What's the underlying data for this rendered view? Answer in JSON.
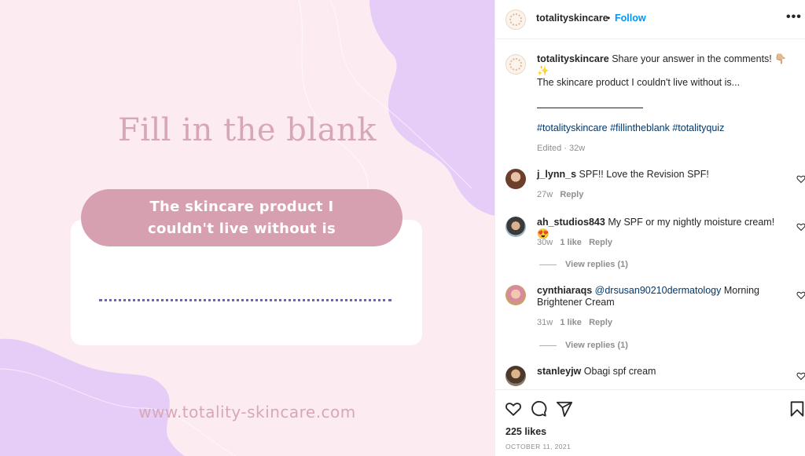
{
  "post_image": {
    "title": "Fill in the blank",
    "pill_text": "The skincare product I couldn't live without is",
    "website": "www.totality-skincare.com",
    "colors": {
      "background": "#fcecf2",
      "blob": "#e6cdf7",
      "pill": "#d7a0b0",
      "title": "#d7a7b5",
      "dotted_line": "#7b56d8"
    }
  },
  "header": {
    "username": "totalityskincare",
    "separator": "•",
    "follow_label": "Follow",
    "more_icon": "more-options-icon",
    "more_glyph": "•••"
  },
  "caption": {
    "username": "totalityskincare",
    "text": "Share your answer in the comments! 👇🏼✨",
    "line2": "The skincare product I couldn't live without is...",
    "hashtags": "#totalityskincare #fillintheblank #totalityquiz",
    "meta": "Edited · 32w"
  },
  "comments": [
    {
      "username": "j_lynn_s",
      "text": "SPF!! Love the Revision SPF!",
      "time": "27w",
      "likes": "",
      "reply": "Reply",
      "view_replies": ""
    },
    {
      "username": "ah_studios843",
      "text": "My SPF or my nightly moisture cream! 😍",
      "time": "30w",
      "likes": "1 like",
      "reply": "Reply",
      "view_replies": "View replies (1)"
    },
    {
      "username": "cynthiaraqs",
      "mention": "@drsusan90210dermatology",
      "text_line1_rest": " Morning",
      "text_line2": "Brightener Cream",
      "time": "31w",
      "likes": "1 like",
      "reply": "Reply",
      "view_replies": "View replies (1)"
    },
    {
      "username": "stanleyjw",
      "text": "Obagi spf cream"
    }
  ],
  "actions": {
    "like_icon": "heart-icon",
    "comment_icon": "comment-icon",
    "share_icon": "share-icon",
    "save_icon": "bookmark-icon",
    "likes_count": "225 likes",
    "date": "OCTOBER 11, 2021"
  }
}
